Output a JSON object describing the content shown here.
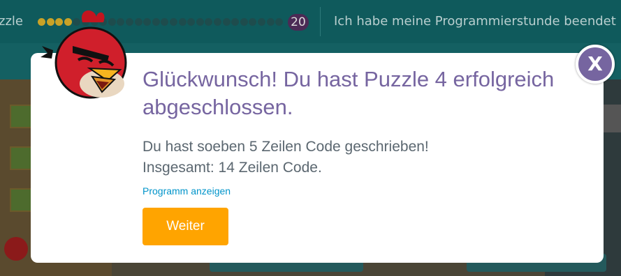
{
  "topbar": {
    "puzzle_label": "zzle",
    "level_count": "20",
    "finish_text": "Ich habe meine Programmierstunde beendet",
    "dots": {
      "total": 28,
      "completed": 4,
      "completed_color": "#c9a227",
      "pending_color": "#1e4c4d"
    }
  },
  "dialog": {
    "title": "Glückwunsch! Du hast Puzzle 4 erfolgreich abgeschlossen.",
    "lines_message": "Du hast soeben 5 Zeilen Code geschrieben!",
    "total_message": "Insgesamt: 14 Zeilen Code.",
    "show_code_link": "Programm anzeigen",
    "continue_label": "Weiter",
    "close_label": "X",
    "avatar_icon": "red-bird-icon"
  },
  "colors": {
    "title": "#7665a0",
    "body": "#5b6770",
    "link": "#0094ca",
    "continue_button": "#ffa400",
    "close_button": "#7665a0",
    "topbar": "#0f5a5c"
  }
}
